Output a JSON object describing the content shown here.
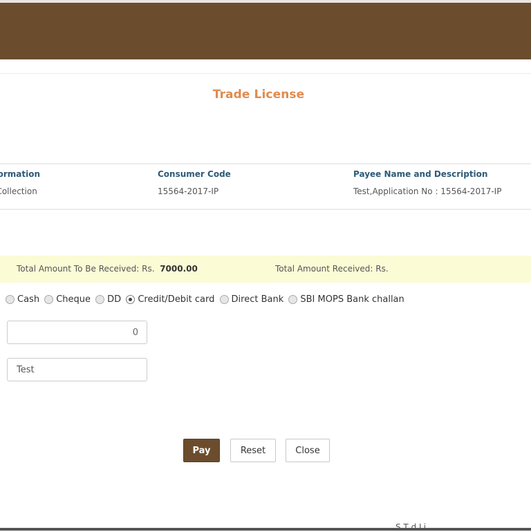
{
  "header": {
    "color": "#6b4d2e"
  },
  "page": {
    "title": "Trade License"
  },
  "info": {
    "columns": [
      {
        "header": "al Information",
        "value": "ense Collection"
      },
      {
        "header": "Consumer Code",
        "value": "15564-2017-IP"
      },
      {
        "header": "Payee Name and Description",
        "value": "Test,Application No : 15564-2017-IP"
      }
    ]
  },
  "amounts": {
    "to_be_received_label": "Total Amount To Be Received: Rs.",
    "to_be_received_value": "7000.00",
    "received_label": "Total Amount Received: Rs."
  },
  "payment_modes": {
    "selected": "Credit/Debit card",
    "options": [
      "Cash",
      "Cheque",
      "DD",
      "Credit/Debit card",
      "Direct Bank",
      "SBI MOPS Bank challan"
    ]
  },
  "form": {
    "amount_value": "0",
    "remarks_value": "Test"
  },
  "buttons": {
    "pay": "Pay",
    "reset": "Reset",
    "close": "Close"
  },
  "footer": {
    "partial_text": "S        T   d  Li"
  },
  "colors": {
    "brand": "#6b4d2e",
    "title": "#e08b4f",
    "column_header": "#2e5a77",
    "amount_band": "#fbfbd5"
  }
}
